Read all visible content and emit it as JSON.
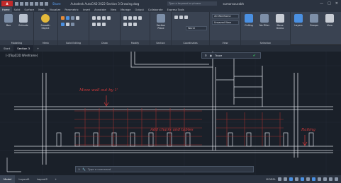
{
  "titlebar": {
    "logo": "A",
    "share": "Share",
    "document": "Autodesk AutoCAD 2022  Section 3 Drawing.dwg",
    "search_placeholder": "Type a keyword or phrase",
    "user": "sumansaurabh",
    "window_controls": [
      "—",
      "□",
      "✕"
    ]
  },
  "tabs": [
    "Home",
    "Solid",
    "Surface",
    "Mesh",
    "Visualize",
    "Parametric",
    "Insert",
    "Annotate",
    "View",
    "Manage",
    "Output",
    "Collaborate",
    "Express Tools"
  ],
  "active_tab": "Home",
  "ribbon": {
    "panels": [
      {
        "title": "Modeling",
        "buttons": [
          "Box",
          "Extrude"
        ]
      },
      {
        "title": "Mesh",
        "buttons": [
          "Smooth Object"
        ]
      },
      {
        "title": "Solid Editing",
        "buttons": []
      },
      {
        "title": "Draw",
        "buttons": []
      },
      {
        "title": "Modify",
        "buttons": []
      },
      {
        "title": "Section",
        "buttons": [
          "Section Plane"
        ]
      },
      {
        "title": "Coordinates",
        "buttons": []
      },
      {
        "title": "View",
        "buttons": []
      },
      {
        "title": "Selection",
        "buttons": [
          "Culling",
          "No Filter",
          "Move Gizmo"
        ]
      },
      {
        "title": "",
        "buttons": [
          "Layers",
          "Groups",
          "View"
        ]
      }
    ],
    "visual_style": "2D Wireframe",
    "view_name": "Unsaved View",
    "ucs": "World"
  },
  "doc_tabs": [
    "Start",
    "Section 3"
  ],
  "active_doc_tab": "Section 3",
  "viewport_label": "[-][Top][2D Wireframe]",
  "trace_toolbar": {
    "label": "Trace"
  },
  "annotations": [
    {
      "text": "Move wall out by 1'"
    },
    {
      "text": "Add chairs and tables"
    },
    {
      "text": "Railing"
    }
  ],
  "command_line": {
    "placeholder": "Type a command"
  },
  "layout_tabs": [
    "Model",
    "Layout1",
    "Layout2"
  ],
  "active_layout": "Model",
  "status": {
    "model_label": "MODEL"
  },
  "colors": {
    "markup": "#d93a3a",
    "accent": "#4a90e2",
    "confirm": "#36c25a"
  }
}
